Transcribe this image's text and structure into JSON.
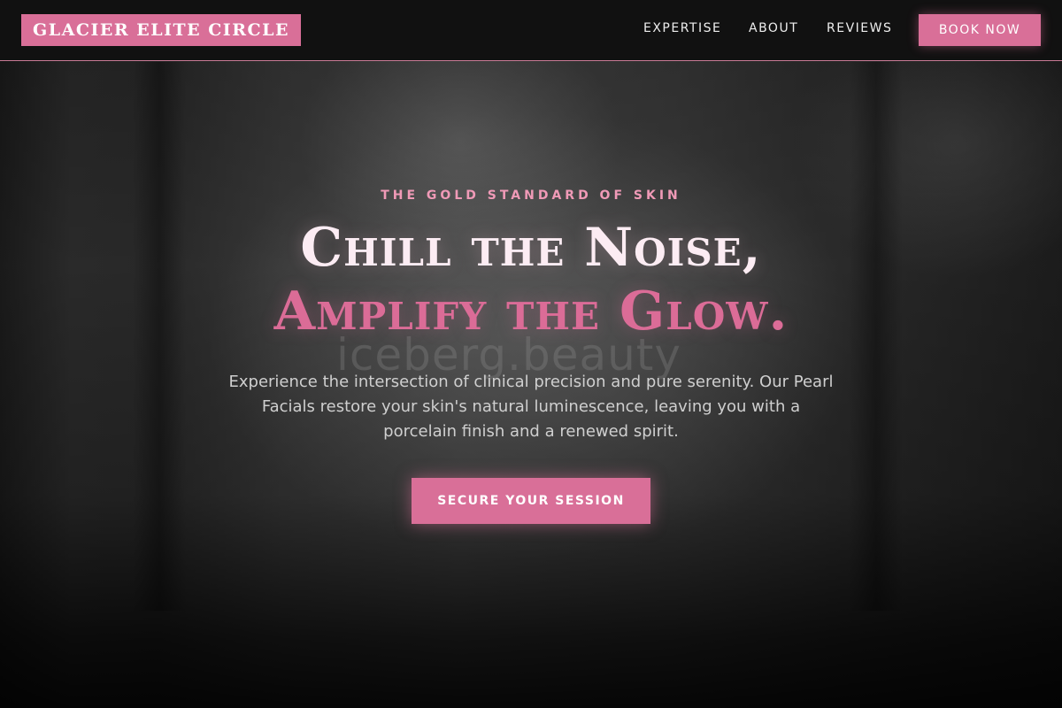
{
  "brand": {
    "logo_text": "GLACIER ELITE CIRCLE",
    "accent_color": "#d96f98",
    "heading_light_color": "#fcecf3",
    "eyebrow_color": "#f09ab7"
  },
  "nav": {
    "items": [
      {
        "label": "EXPERTISE"
      },
      {
        "label": "ABOUT"
      },
      {
        "label": "REVIEWS"
      }
    ],
    "cta_label": "BOOK NOW"
  },
  "hero": {
    "eyebrow": "THE GOLD STANDARD OF SKIN",
    "headline_line1": "Chill the Noise,",
    "headline_line2": "Amplify the Glow.",
    "description": "Experience the intersection of clinical precision and pure serenity. Our Pearl Facials restore your skin's natural luminescence, leaving you with a porcelain finish and a renewed spirit.",
    "cta_label": "SECURE YOUR SESSION",
    "background_watermark": "iceberg.beauty"
  }
}
